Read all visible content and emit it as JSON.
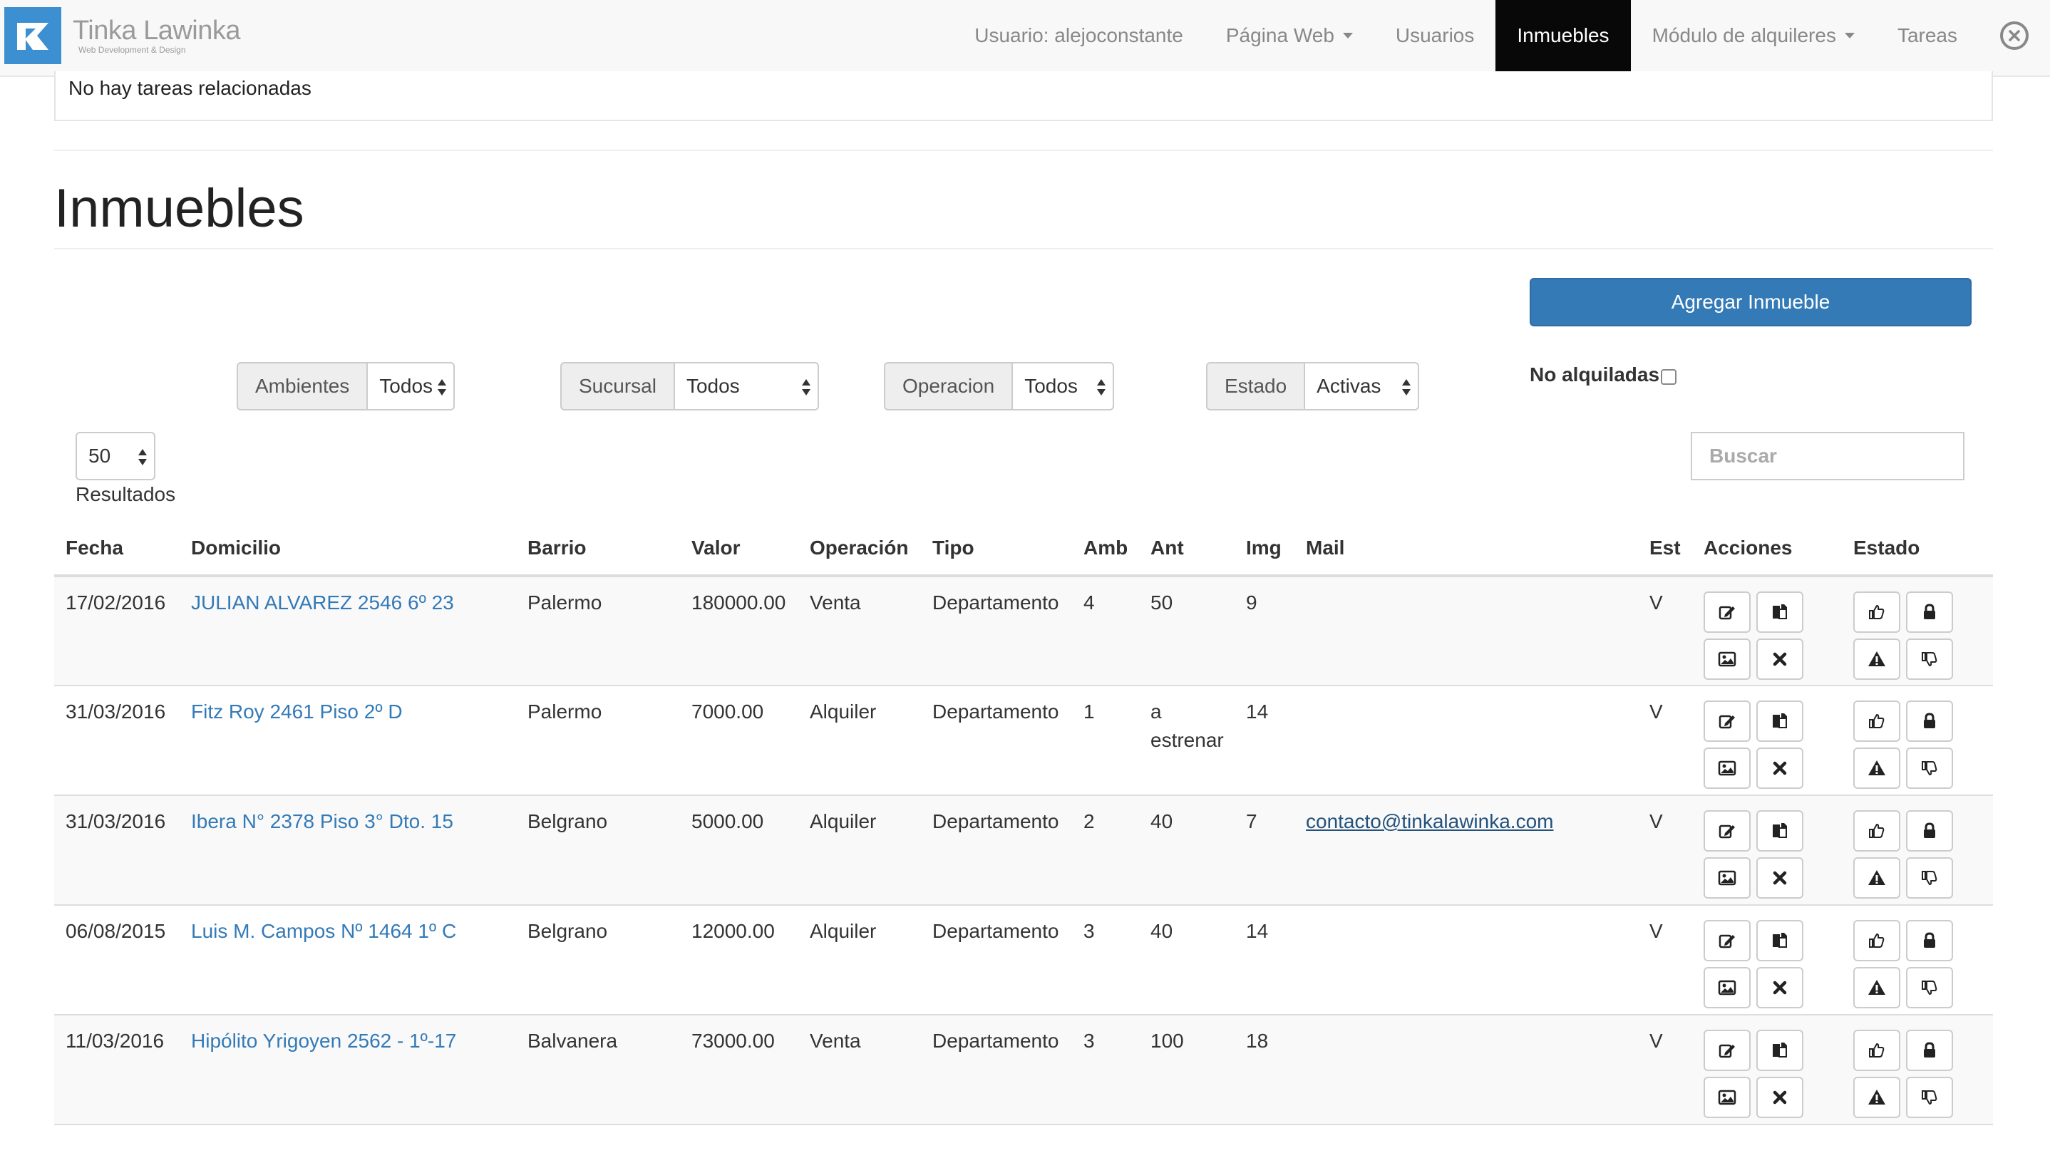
{
  "brand": {
    "name": "Tinka Lawinka",
    "tagline": "Web Development & Design"
  },
  "nav": {
    "user": "Usuario: alejoconstante",
    "web": "Página Web",
    "usuarios": "Usuarios",
    "inmuebles": "Inmuebles",
    "alquileres": "Módulo de alquileres",
    "tareas": "Tareas"
  },
  "tasks": {
    "empty_text": "No hay tareas relacionadas"
  },
  "page": {
    "title": "Inmuebles",
    "add_button": "Agregar Inmueble"
  },
  "filters": {
    "ambientes": {
      "label": "Ambientes",
      "value": "Todos"
    },
    "sucursal": {
      "label": "Sucursal",
      "value": "Todos"
    },
    "operacion": {
      "label": "Operacion",
      "value": "Todos"
    },
    "estado": {
      "label": "Estado",
      "value": "Activas"
    },
    "no_alquiladas": {
      "label": "No alquiladas",
      "checked": false
    }
  },
  "results": {
    "per_page": "50",
    "label": "Resultados"
  },
  "search": {
    "placeholder": "Buscar"
  },
  "table": {
    "headers": {
      "fecha": "Fecha",
      "domicilio": "Domicilio",
      "barrio": "Barrio",
      "valor": "Valor",
      "operacion": "Operación",
      "tipo": "Tipo",
      "amb": "Amb",
      "ant": "Ant",
      "img": "Img",
      "mail": "Mail",
      "est": "Est",
      "acciones": "Acciones",
      "estado": "Estado"
    },
    "rows": [
      {
        "fecha": "17/02/2016",
        "domicilio": "JULIAN ALVAREZ 2546 6º 23",
        "barrio": "Palermo",
        "valor": "180000.00",
        "operacion": "Venta",
        "tipo": "Departamento",
        "amb": "4",
        "ant": "50",
        "img": "9",
        "mail": "",
        "est": "V"
      },
      {
        "fecha": "31/03/2016",
        "domicilio": "Fitz Roy 2461 Piso 2º D",
        "barrio": "Palermo",
        "valor": "7000.00",
        "operacion": "Alquiler",
        "tipo": "Departamento",
        "amb": "1",
        "ant": "a estrenar",
        "img": "14",
        "mail": "",
        "est": "V"
      },
      {
        "fecha": "31/03/2016",
        "domicilio": "Ibera N° 2378 Piso 3° Dto. 15",
        "barrio": "Belgrano",
        "valor": "5000.00",
        "operacion": "Alquiler",
        "tipo": "Departamento",
        "amb": "2",
        "ant": "40",
        "img": "7",
        "mail": "contacto@tinkalawinka.com",
        "est": "V"
      },
      {
        "fecha": "06/08/2015",
        "domicilio": "Luis M. Campos Nº 1464 1º C",
        "barrio": "Belgrano",
        "valor": "12000.00",
        "operacion": "Alquiler",
        "tipo": "Departamento",
        "amb": "3",
        "ant": "40",
        "img": "14",
        "mail": "",
        "est": "V"
      },
      {
        "fecha": "11/03/2016",
        "domicilio": "Hipólito Yrigoyen 2562 - 1º-17",
        "barrio": "Balvanera",
        "valor": "73000.00",
        "operacion": "Venta",
        "tipo": "Departamento",
        "amb": "3",
        "ant": "100",
        "img": "18",
        "mail": "",
        "est": "V"
      }
    ],
    "action_icons": [
      "edit-icon",
      "copy-icon",
      "image-icon",
      "delete-icon"
    ],
    "estado_icons": [
      "thumbs-up-icon",
      "lock-icon",
      "warning-icon",
      "thumbs-down-icon"
    ]
  },
  "colors": {
    "primary": "#337ab7",
    "nav_active": "#080808",
    "link": "#337ab7",
    "brand_logo": "#3c8fd1"
  }
}
